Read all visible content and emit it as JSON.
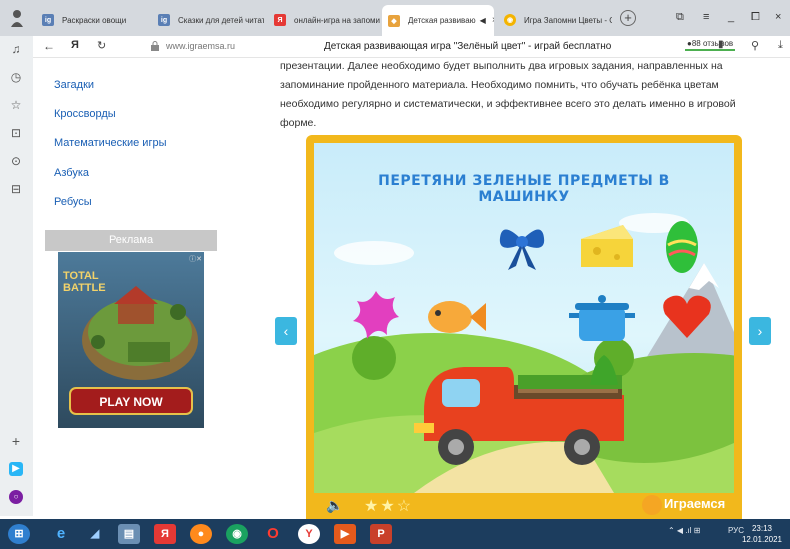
{
  "browser": {
    "tabs": [
      {
        "label": "Раскраски овощи",
        "icon_text": "ig",
        "color": "#5a7fb5",
        "active": false
      },
      {
        "label": "Сказки для детей читать",
        "icon_text": "ig",
        "color": "#5a7fb5",
        "active": false
      },
      {
        "label": "онлайн-игра на запомин",
        "icon_text": "Я",
        "color": "#e53935",
        "active": false
      },
      {
        "label": "Детская развиваю",
        "icon_text": "◆",
        "color": "#e8a33d",
        "active": true
      },
      {
        "label": "Игра Запомни Цветы - О",
        "icon_text": "◉",
        "color": "#f4b400",
        "active": false
      }
    ],
    "back": "←",
    "yandex_logo": "Я",
    "reload": "↻",
    "url": "www.igraemsa.ru",
    "page_title": "Детская развивающая игра \"Зелёный цвет\" - играй бесплатно",
    "reviews": "88 отзывов"
  },
  "sidebar": {
    "items": [
      "Загадки",
      "Кроссворды",
      "Математические игры",
      "Азбука",
      "Ребусы"
    ],
    "ad_header": "Реклама",
    "ad_game_title_1": "TOTAL",
    "ad_game_title_2": "BATTLE",
    "ad_button": "PLAY NOW"
  },
  "article": {
    "text": "презентации. Далее необходимо будет выполнить два игровых задания, направленных на запоминание пройденного материала. Необходимо помнить, что обучать ребёнка цветам необходимо регулярно и систематически, и эффективнее всего это делать именно в игровой форме."
  },
  "game": {
    "title": "ПЕРЕТЯНИ ЗЕЛЕНЫЕ ПРЕДМЕТЫ В МАШИНКУ",
    "prev": "‹",
    "next": "›",
    "logo": "Играемся"
  },
  "taskbar": {
    "lang": "РУС",
    "time": "23:13",
    "date": "12.01.2021"
  }
}
